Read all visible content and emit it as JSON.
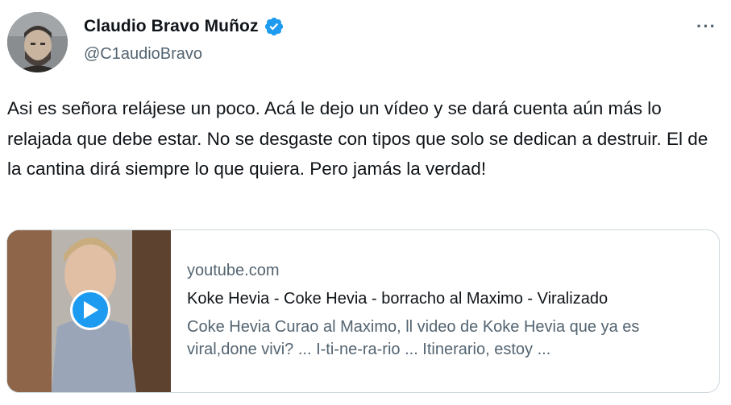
{
  "tweet": {
    "author": {
      "display_name": "Claudio Bravo Muñoz",
      "handle": "@C1audioBravo",
      "verified_icon": "verified-badge-icon",
      "verified_color": "#1d9bf0"
    },
    "more_label": "···",
    "text": "Asi es señora relájese un poco. Acá le dejo un vídeo y se dará cuenta aún más lo relajada que debe estar. No se desgaste con tipos que solo se dedican a destruir. El de la cantina dirá siempre lo que quiera. Pero jamás la verdad!",
    "card": {
      "domain": "youtube.com",
      "title": "Koke Hevia - Coke Hevia - borracho al Maximo - Viralizado",
      "description": "Coke Hevia Curao al Maximo, ll video de Koke Hevia que ya es viral,done vivi? ... I-ti-ne-ra-rio ... Itinerario, estoy ...",
      "play_icon": "play-icon"
    }
  }
}
